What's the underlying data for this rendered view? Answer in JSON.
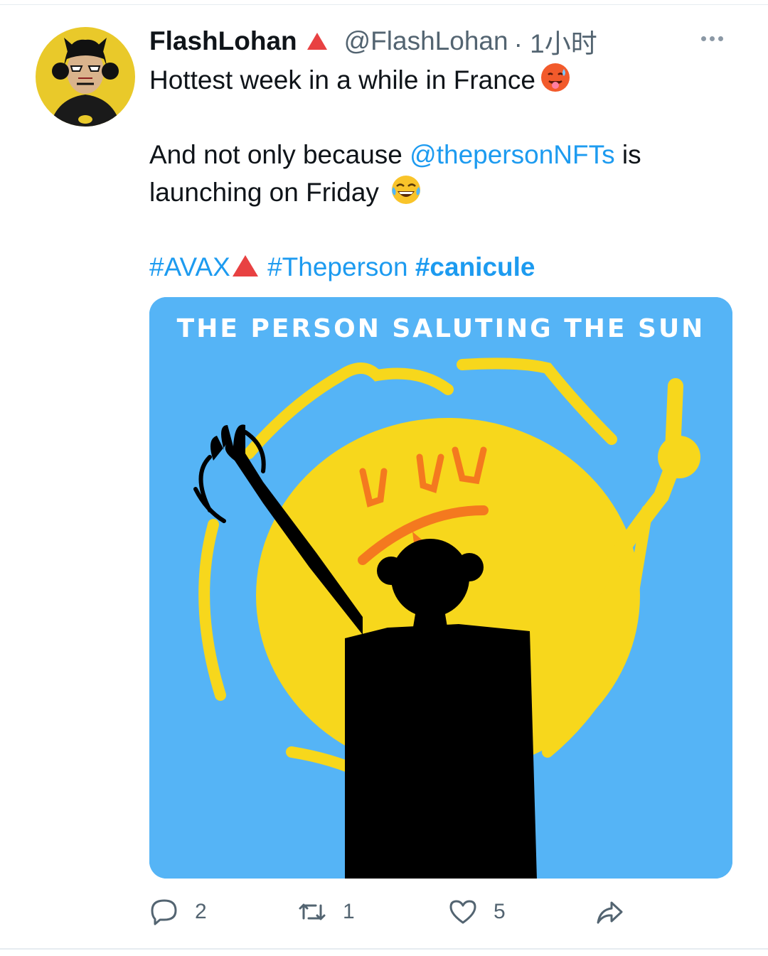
{
  "tweet": {
    "author_name": "FlashLohan",
    "handle": "@FlashLohan",
    "time": "· 1小时",
    "line1": "Hottest week in a while in France",
    "line2a": "And not only because ",
    "mention": "@thepersonNFTs",
    "line2b": " is",
    "line3": "launching on Friday ",
    "hashtags": [
      "#AVAX",
      "#Theperson",
      "#canicule"
    ],
    "image_caption": "THE PERSON SALUTING THE SUN"
  },
  "actions": {
    "reply_count": "2",
    "retweet_count": "1",
    "like_count": "5"
  },
  "colors": {
    "link": "#1d9bf0",
    "avax_red": "#e84142",
    "sky": "#55b4f6",
    "sun": "#f7d71c"
  },
  "icons": [
    "more-icon",
    "hot-face-emoji",
    "laughing-emoji",
    "avax-triangle-icon",
    "reply-icon",
    "retweet-icon",
    "like-icon",
    "share-icon"
  ]
}
